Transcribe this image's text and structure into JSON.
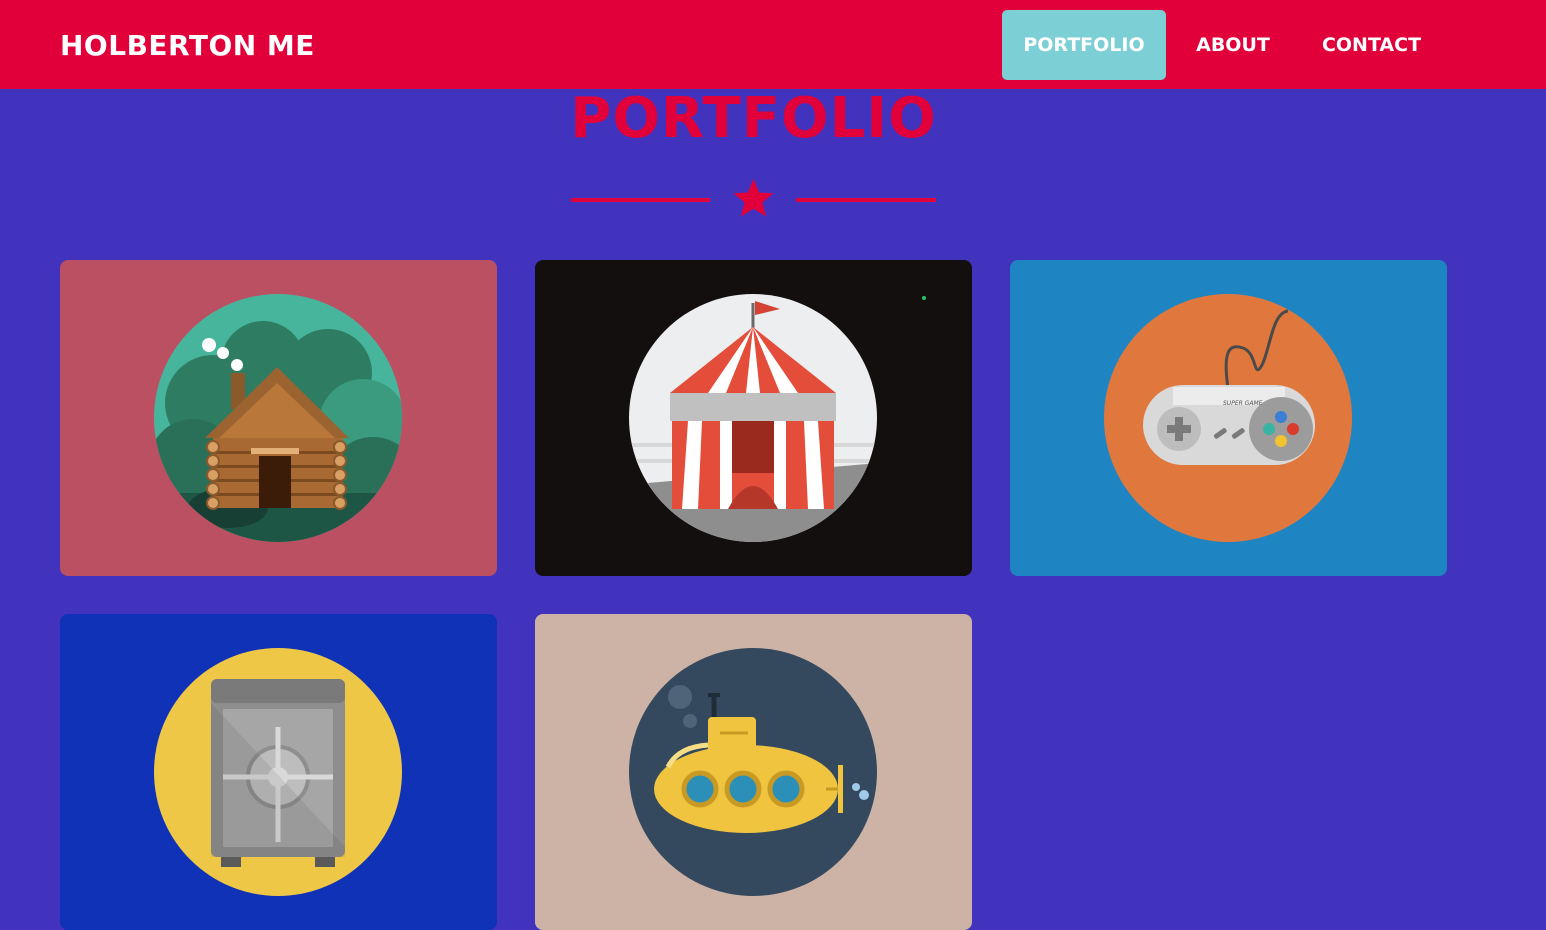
{
  "navbar": {
    "brand": "HOLBERTON ME",
    "items": [
      {
        "label": "PORTFOLIO",
        "active": true
      },
      {
        "label": "ABOUT",
        "active": false
      },
      {
        "label": "CONTACT",
        "active": false
      }
    ]
  },
  "section": {
    "title": "PORTFOLIO",
    "divider_icon": "star-icon"
  },
  "portfolio": {
    "items": [
      {
        "icon": "log-cabin-icon",
        "background": "#bb5063"
      },
      {
        "icon": "circus-tent-icon",
        "background": "#130f0f"
      },
      {
        "icon": "game-controller-icon",
        "background": "#1f85c2",
        "controller_text": "SUPER GAME"
      },
      {
        "icon": "safe-icon",
        "background": "#1032b7"
      },
      {
        "icon": "submarine-icon",
        "background": "#cdb3a6"
      }
    ]
  },
  "colors": {
    "navbar": "#e1003a",
    "page_background": "#4233bf",
    "active_nav": "#7ccfd4",
    "accent": "#e1003a"
  }
}
